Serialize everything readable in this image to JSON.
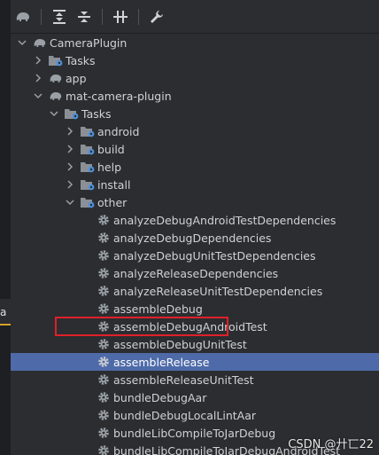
{
  "gutter_tab": {
    "label": "a"
  },
  "toolbar": {
    "buttons": [
      {
        "icon": "elephant-icon"
      },
      {
        "icon": "expand-all-icon"
      },
      {
        "icon": "collapse-all-icon"
      },
      {
        "icon": "toggle-offline-icon"
      },
      {
        "icon": "wrench-icon"
      }
    ]
  },
  "tree": {
    "project": "CameraPlugin",
    "project_tasks": "Tasks",
    "app": "app",
    "module": "mat-camera-plugin",
    "module_tasks": "Tasks",
    "groups": [
      "android",
      "build",
      "help",
      "install",
      "other"
    ],
    "tasks": [
      "analyzeDebugAndroidTestDependencies",
      "analyzeDebugDependencies",
      "analyzeDebugUnitTestDependencies",
      "analyzeReleaseDependencies",
      "analyzeReleaseUnitTestDependencies",
      "assembleDebug",
      "assembleDebugAndroidTest",
      "assembleDebugUnitTest",
      "assembleRelease",
      "assembleReleaseUnitTest",
      "bundleDebugAar",
      "bundleDebugLocalLintAar",
      "bundleLibCompileToJarDebug",
      "bundleLibCompileToJarDebugAndroidTest"
    ],
    "selected_task": "assembleRelease"
  },
  "watermark": "CSDN @廾匸22",
  "colors": {
    "background": "#2b2d30",
    "selection": "#4e6aa8",
    "highlight_border": "#e0202a",
    "icon": "#9aa0a6"
  }
}
